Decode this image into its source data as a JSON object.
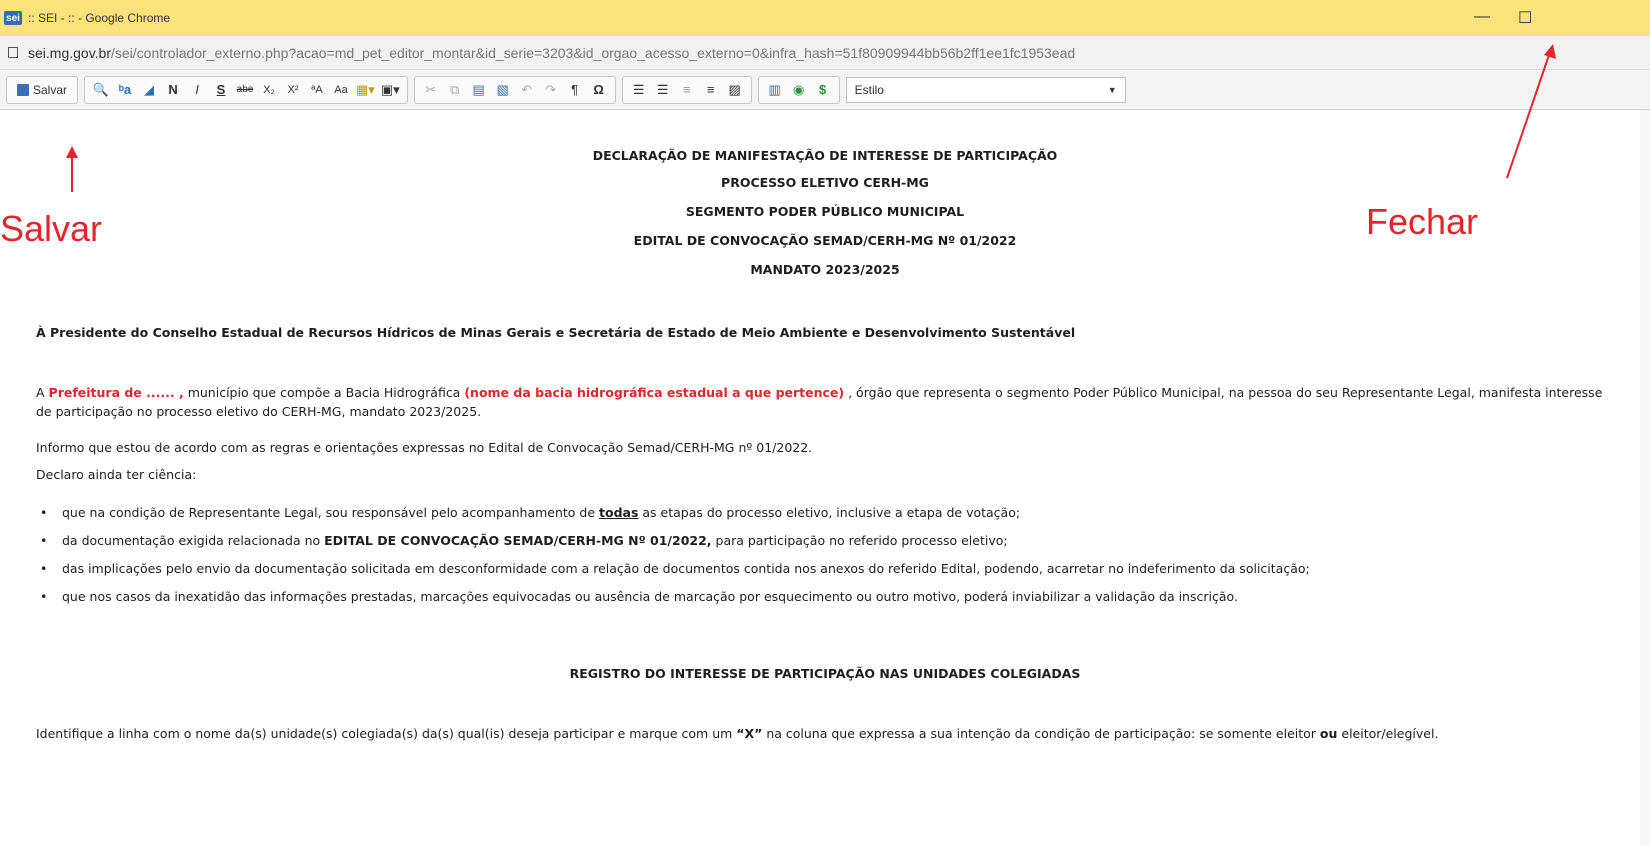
{
  "window": {
    "title": ":: SEI - :: - Google Chrome",
    "logo_text": "sei",
    "minimize_label": "—",
    "maximize_label": "☐"
  },
  "address_bar": {
    "host": "sei.mg.gov.br",
    "path": "/sei/controlador_externo.php?acao=md_pet_editor_montar&id_serie=3203&id_orgao_acesso_externo=0&infra_hash=51f80909944bb56b2ff1ee1fc1953ead"
  },
  "toolbar": {
    "save_label": "Salvar",
    "bold": "N",
    "italic": "I",
    "underline": "S",
    "strike": "abe",
    "subscript": "X₂",
    "superscript": "X²",
    "omega": "Ω",
    "pilcrow": "¶",
    "dollar": "$",
    "styles_label": "Estilo"
  },
  "annotations": {
    "save": "Salvar",
    "close": "Fechar"
  },
  "document": {
    "headings": [
      "DECLARAÇÃO DE MANIFESTAÇÃO DE INTERESSE DE PARTICIPAÇÃO",
      "PROCESSO ELETIVO CERH-MG",
      "SEGMENTO PODER PÚBLICO MUNICIPAL",
      "EDITAL DE CONVOCAÇÃO SEMAD/CERH-MG Nº 01/2022",
      "MANDATO 2023/2025"
    ],
    "addressee": "À Presidente do Conselho Estadual de Recursos Hídricos de Minas Gerais e Secretária de Estado de Meio Ambiente e Desenvolvimento Sustentável",
    "para1": {
      "prefix": "A ",
      "prefeitura": "Prefeitura de ...... ,",
      "middle": " município que compõe a Bacia Hidrográfica ",
      "bacia": "(nome da bacia hidrográfica estadual a que pertence)",
      "rest": " , órgão que representa o segmento Poder Público Municipal, na pessoa do seu Representante Legal, manifesta interesse de participação no processo eletivo do CERH-MG, mandato 2023/2025."
    },
    "para2": "Informo que estou de acordo com as regras e orientações expressas no Edital de Convocação Semad/CERH-MG nº 01/2022.",
    "para3": "Declaro ainda ter ciência:",
    "bullets": {
      "b1_a": "que na condição de Representante Legal, sou responsável pelo acompanhamento de ",
      "b1_b": "todas",
      "b1_c": " as etapas do processo eletivo, inclusive a etapa de votação;",
      "b2_a": "da documentação exigida relacionada no ",
      "b2_b": "EDITAL DE CONVOCAÇÃO SEMAD/CERH-MG Nº 01/2022,",
      "b2_c": " para participação no referido processo eletivo;",
      "b3": "das implicações pelo envio da documentação solicitada em desconformidade com a relação de documentos contida nos anexos do referido Edital, podendo, acarretar no indeferimento da solicitação;",
      "b4": "que nos casos da inexatidão das informações prestadas, marcações equivocadas ou ausência de marcação por esquecimento ou outro motivo, poderá inviabilizar a validação da inscrição."
    },
    "section_heading": "REGISTRO DO INTERESSE DE PARTICIPAÇÃO NAS UNIDADES COLEGIADAS",
    "instructions": {
      "a": "Identifique a linha com o nome da(s) unidade(s) colegiada(s) da(s) qual(is) deseja participar e marque com um ",
      "x": "“X”",
      "b": " na coluna que expressa a sua intenção da condição de participação: se somente eleitor ",
      "ou": "ou",
      "c": " eleitor/elegível."
    }
  }
}
